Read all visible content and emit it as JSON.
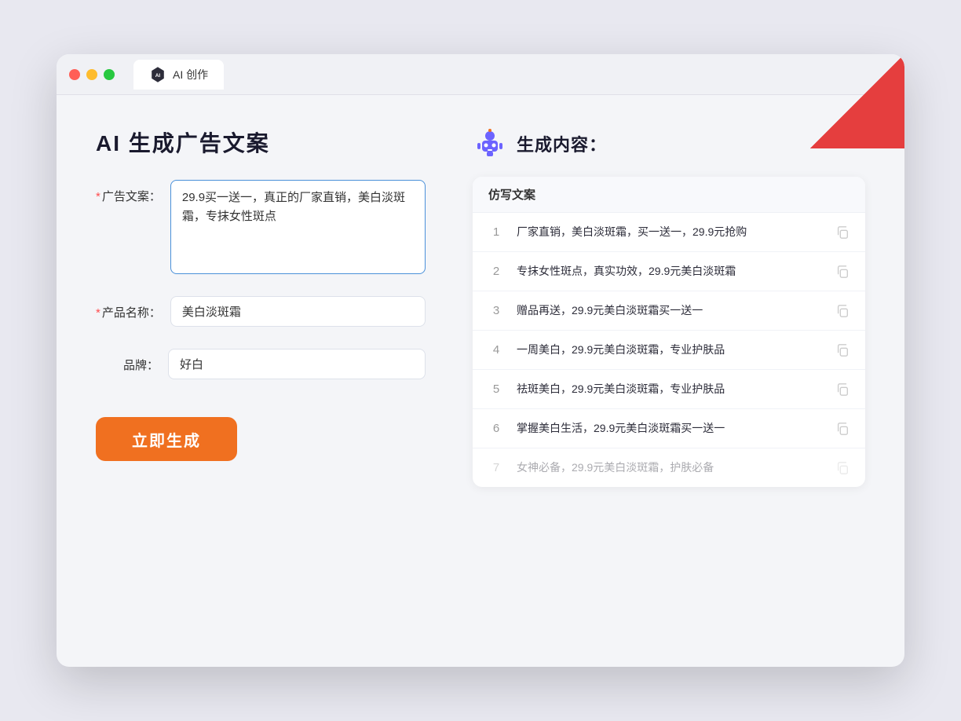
{
  "browser": {
    "tab_label": "AI 创作",
    "traffic_lights": [
      "red",
      "yellow",
      "green"
    ]
  },
  "left_panel": {
    "page_title": "AI 生成广告文案",
    "form": {
      "ad_copy_label": "广告文案：",
      "ad_copy_required": "*",
      "ad_copy_value": "29.9买一送一，真正的厂家直销，美白淡斑霜，专抹女性斑点",
      "product_name_label": "产品名称：",
      "product_name_required": "*",
      "product_name_value": "美白淡斑霜",
      "brand_label": "品牌：",
      "brand_value": "好白"
    },
    "generate_btn": "立即生成"
  },
  "right_panel": {
    "title": "生成内容：",
    "table_header": "仿写文案",
    "results": [
      {
        "index": 1,
        "text": "厂家直销，美白淡斑霜，买一送一，29.9元抢购"
      },
      {
        "index": 2,
        "text": "专抹女性斑点，真实功效，29.9元美白淡斑霜"
      },
      {
        "index": 3,
        "text": "赠品再送，29.9元美白淡斑霜买一送一"
      },
      {
        "index": 4,
        "text": "一周美白，29.9元美白淡斑霜，专业护肤品"
      },
      {
        "index": 5,
        "text": "祛斑美白，29.9元美白淡斑霜，专业护肤品"
      },
      {
        "index": 6,
        "text": "掌握美白生活，29.9元美白淡斑霜买一送一"
      },
      {
        "index": 7,
        "text": "女神必备，29.9元美白淡斑霜，护肤必备",
        "faded": true
      }
    ]
  }
}
